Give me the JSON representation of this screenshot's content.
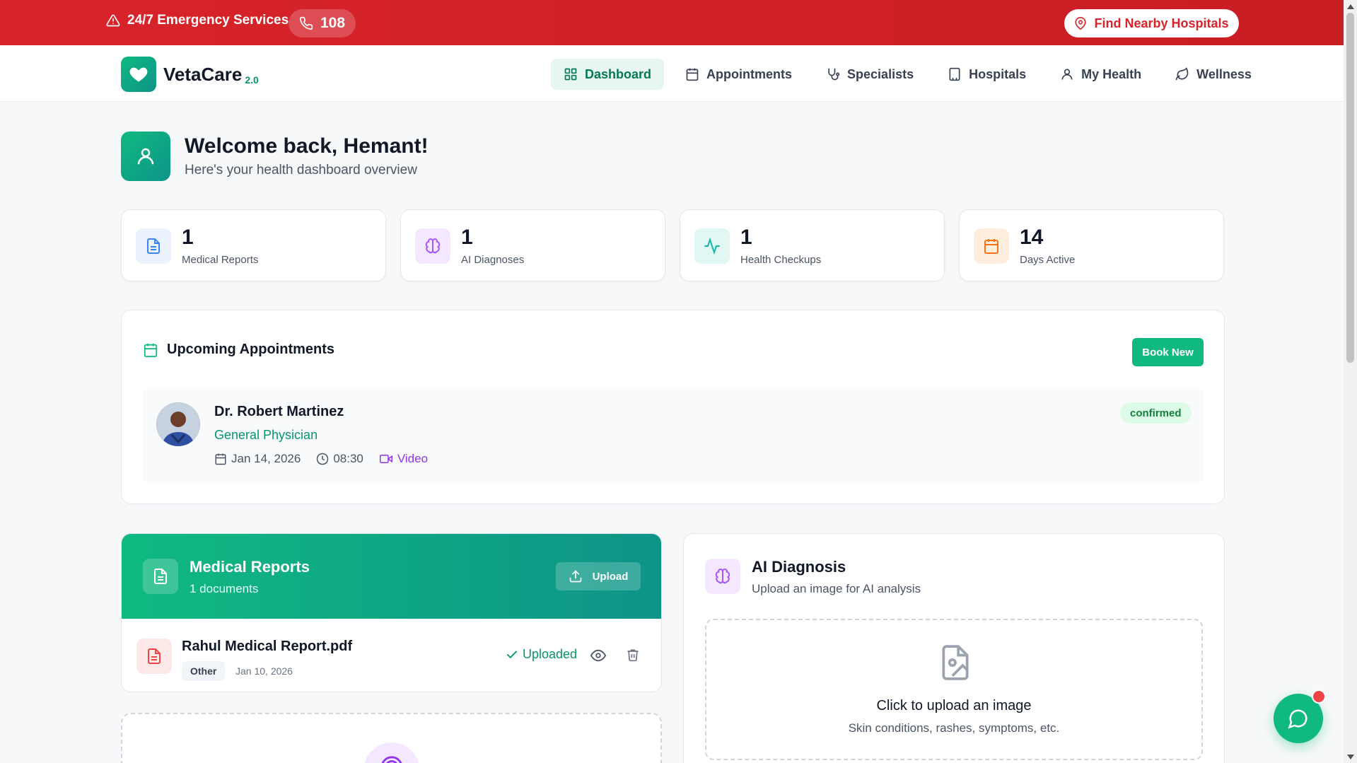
{
  "emergency": {
    "label": "24/7 Emergency Services",
    "phone": "108",
    "find_hospitals": "Find Nearby Hospitals"
  },
  "brand": {
    "name": "VetaCare",
    "version": "2.0"
  },
  "nav": {
    "items": [
      {
        "label": "Dashboard",
        "icon": "grid-icon",
        "active": true
      },
      {
        "label": "Appointments",
        "icon": "calendar-icon"
      },
      {
        "label": "Specialists",
        "icon": "stethoscope-icon"
      },
      {
        "label": "Hospitals",
        "icon": "building-icon"
      },
      {
        "label": "My Health",
        "icon": "user-icon"
      },
      {
        "label": "Wellness",
        "icon": "leaf-icon"
      }
    ]
  },
  "welcome": {
    "title": "Welcome back, Hemant!",
    "subtitle": "Here's your health dashboard overview"
  },
  "stats": [
    {
      "value": "1",
      "label": "Medical Reports",
      "icon": "document-icon",
      "color": "#3b82f6"
    },
    {
      "value": "1",
      "label": "AI Diagnoses",
      "icon": "brain-icon",
      "color": "#a855f7"
    },
    {
      "value": "1",
      "label": "Health Checkups",
      "icon": "activity-icon",
      "color": "#14b8a6"
    },
    {
      "value": "14",
      "label": "Days Active",
      "icon": "calendar-icon",
      "color": "#f97316"
    }
  ],
  "appointments": {
    "title": "Upcoming Appointments",
    "book_label": "Book New",
    "items": [
      {
        "doctor": "Dr. Robert Martinez",
        "specialty": "General Physician",
        "date": "Jan 14, 2026",
        "time": "08:30",
        "mode": "Video",
        "status": "confirmed"
      }
    ]
  },
  "reports": {
    "title": "Medical Reports",
    "count_label": "1 documents",
    "upload_label": "Upload",
    "files": [
      {
        "name": "Rahul Medical Report.pdf",
        "tag": "Other",
        "date": "Jan 10, 2026",
        "status": "Uploaded"
      }
    ]
  },
  "ai": {
    "title": "AI Diagnosis",
    "subtitle": "Upload an image for AI analysis",
    "drop_title": "Click to upload an image",
    "drop_sub": "Skin conditions, rashes, symptoms, etc."
  },
  "colors": {
    "accent": "#10b981",
    "emergency": "#d8232a"
  }
}
